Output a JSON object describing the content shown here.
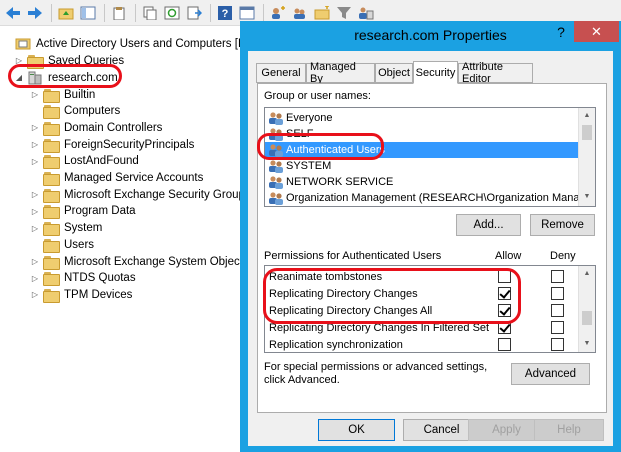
{
  "tree": {
    "root": "Active Directory Users and Computers [DC",
    "saved_queries": "Saved Queries",
    "domain": "research.com",
    "children": [
      {
        "label": "Builtin",
        "expander": true
      },
      {
        "label": "Computers",
        "expander": false
      },
      {
        "label": "Domain Controllers",
        "expander": true
      },
      {
        "label": "ForeignSecurityPrincipals",
        "expander": true
      },
      {
        "label": "LostAndFound",
        "expander": true
      },
      {
        "label": "Managed Service Accounts",
        "expander": false
      },
      {
        "label": "Microsoft Exchange Security Group",
        "expander": true
      },
      {
        "label": "Program Data",
        "expander": true
      },
      {
        "label": "System",
        "expander": true
      },
      {
        "label": "Users",
        "expander": false
      },
      {
        "label": "Microsoft Exchange System Objects",
        "expander": true
      },
      {
        "label": "NTDS Quotas",
        "expander": true
      },
      {
        "label": "TPM Devices",
        "expander": true
      }
    ]
  },
  "dialog": {
    "title": "research.com Properties",
    "help": "?",
    "close": "✕",
    "tabs": [
      "General",
      "Managed By",
      "Object",
      "Security",
      "Attribute Editor"
    ],
    "selected_tab": "Security",
    "group_label": "Group or user names:",
    "users": [
      "Everyone",
      "SELF",
      "Authenticated Users",
      "SYSTEM",
      "NETWORK SERVICE",
      "Organization Management (RESEARCH\\Organization Manage..."
    ],
    "selected_user": "Authenticated Users",
    "add_button": "Add...",
    "remove_button": "Remove",
    "permissions_label": "Permissions for Authenticated Users",
    "allow_header": "Allow",
    "deny_header": "Deny",
    "permissions": [
      {
        "name": "Reanimate tombstones",
        "allow": false,
        "deny": false
      },
      {
        "name": "Replicating Directory Changes",
        "allow": true,
        "deny": false
      },
      {
        "name": "Replicating Directory Changes All",
        "allow": true,
        "deny": false
      },
      {
        "name": "Replicating Directory Changes In Filtered Set",
        "allow": true,
        "deny": false
      },
      {
        "name": "Replication synchronization",
        "allow": false,
        "deny": false
      }
    ],
    "special_text": "For special permissions or advanced settings, click Advanced.",
    "advanced_button": "Advanced",
    "ok_button": "OK",
    "cancel_button": "Cancel",
    "apply_button": "Apply",
    "help_button": "Help"
  },
  "colors": {
    "accent": "#1ba1e2",
    "selection": "#3399ff",
    "highlight_annotation": "#e8101a",
    "close": "#c75050"
  }
}
